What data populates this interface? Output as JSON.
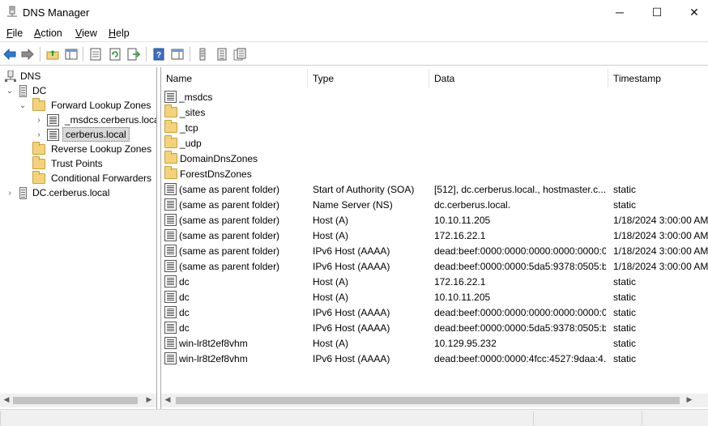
{
  "window": {
    "title": "DNS Manager",
    "minimize_glyph": "─",
    "maximize_glyph": "☐",
    "close_glyph": "✕"
  },
  "menu": [
    {
      "label": "File",
      "underline": "F",
      "rest": "ile"
    },
    {
      "label": "Action",
      "underline": "A",
      "rest": "ction"
    },
    {
      "label": "View",
      "underline": "V",
      "rest": "iew"
    },
    {
      "label": "Help",
      "underline": "H",
      "rest": "elp"
    }
  ],
  "toolbar": {
    "icons": [
      "back-arrow-icon",
      "forward-arrow-icon",
      "up-folder-icon",
      "show-hide-tree-icon",
      "properties-icon",
      "refresh-icon",
      "export-list-icon",
      "help-icon",
      "show-hide-action-pane-icon",
      "new-record-icon",
      "new-host-icon",
      "new-alias-icon"
    ]
  },
  "tree": {
    "root": "DNS",
    "server": "DC",
    "forward_zones": "Forward Lookup Zones",
    "zone_msdcs": "_msdcs.cerberus.local",
    "zone_cerberus": "cerberus.local",
    "reverse_zones": "Reverse Lookup Zones",
    "trust_points": "Trust Points",
    "conditional_forwarders": "Conditional Forwarders",
    "server2": "DC.cerberus.local"
  },
  "columns": {
    "name": "Name",
    "type": "Type",
    "data": "Data",
    "timestamp": "Timestamp"
  },
  "records": [
    {
      "icon": "zone",
      "name": "_msdcs",
      "type": "",
      "data": "",
      "timestamp": ""
    },
    {
      "icon": "folder",
      "name": "_sites",
      "type": "",
      "data": "",
      "timestamp": ""
    },
    {
      "icon": "folder",
      "name": "_tcp",
      "type": "",
      "data": "",
      "timestamp": ""
    },
    {
      "icon": "folder",
      "name": "_udp",
      "type": "",
      "data": "",
      "timestamp": ""
    },
    {
      "icon": "folder",
      "name": "DomainDnsZones",
      "type": "",
      "data": "",
      "timestamp": ""
    },
    {
      "icon": "folder",
      "name": "ForestDnsZones",
      "type": "",
      "data": "",
      "timestamp": ""
    },
    {
      "icon": "record",
      "name": "(same as parent folder)",
      "type": "Start of Authority (SOA)",
      "data": "[512], dc.cerberus.local., hostmaster.c...",
      "timestamp": "static"
    },
    {
      "icon": "record",
      "name": "(same as parent folder)",
      "type": "Name Server (NS)",
      "data": "dc.cerberus.local.",
      "timestamp": "static"
    },
    {
      "icon": "record",
      "name": "(same as parent folder)",
      "type": "Host (A)",
      "data": "10.10.11.205",
      "timestamp": "1/18/2024 3:00:00 AM"
    },
    {
      "icon": "record",
      "name": "(same as parent folder)",
      "type": "Host (A)",
      "data": "172.16.22.1",
      "timestamp": "1/18/2024 3:00:00 AM"
    },
    {
      "icon": "record",
      "name": "(same as parent folder)",
      "type": "IPv6 Host (AAAA)",
      "data": "dead:beef:0000:0000:0000:0000:0000:0...",
      "timestamp": "1/18/2024 3:00:00 AM"
    },
    {
      "icon": "record",
      "name": "(same as parent folder)",
      "type": "IPv6 Host (AAAA)",
      "data": "dead:beef:0000:0000:5da5:9378:0505:b...",
      "timestamp": "1/18/2024 3:00:00 AM"
    },
    {
      "icon": "record",
      "name": "dc",
      "type": "Host (A)",
      "data": "172.16.22.1",
      "timestamp": "static"
    },
    {
      "icon": "record",
      "name": "dc",
      "type": "Host (A)",
      "data": "10.10.11.205",
      "timestamp": "static"
    },
    {
      "icon": "record",
      "name": "dc",
      "type": "IPv6 Host (AAAA)",
      "data": "dead:beef:0000:0000:0000:0000:0000:0...",
      "timestamp": "static"
    },
    {
      "icon": "record",
      "name": "dc",
      "type": "IPv6 Host (AAAA)",
      "data": "dead:beef:0000:0000:5da5:9378:0505:b...",
      "timestamp": "static"
    },
    {
      "icon": "record",
      "name": "win-lr8t2ef8vhm",
      "type": "Host (A)",
      "data": "10.129.95.232",
      "timestamp": "static"
    },
    {
      "icon": "record",
      "name": "win-lr8t2ef8vhm",
      "type": "IPv6 Host (AAAA)",
      "data": "dead:beef:0000:0000:4fcc:4527:9daa:4...",
      "timestamp": "static"
    }
  ],
  "colors": {
    "folder": "#f3d27a",
    "selection": "#d9d9d9",
    "accent_blue": "#1e6fd0"
  }
}
